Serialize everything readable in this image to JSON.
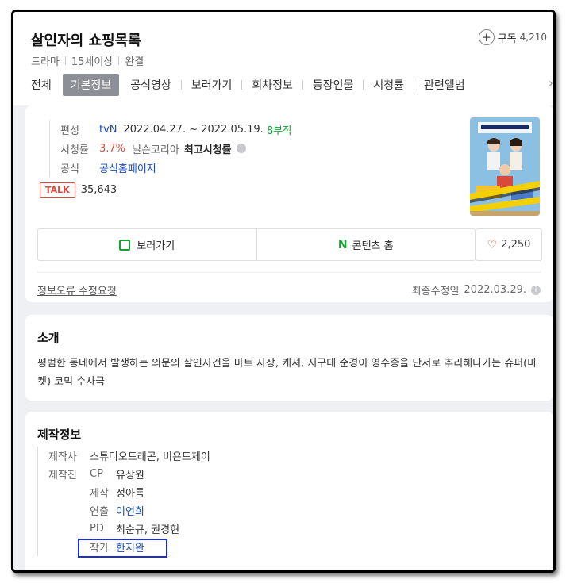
{
  "header": {
    "title": "살인자의 쇼핑목록",
    "subscribe_label": "구독",
    "subscribe_count": "4,210",
    "meta": [
      "드라마",
      "15세이상",
      "완결"
    ]
  },
  "tabs": [
    "전체",
    "기본정보",
    "공식영상",
    "보러가기",
    "회차정보",
    "등장인물",
    "시청률",
    "관련앨범"
  ],
  "active_tab": "기본정보",
  "info": {
    "broadcast_label": "편성",
    "channel": "tvN",
    "period": "2022.04.27. ~ 2022.05.19.",
    "episodes": "8부작",
    "rating_label": "시청률",
    "rating_value": "3.7%",
    "rating_source": "닐슨코리아",
    "rating_type": "최고시청률",
    "official_label": "공식",
    "official_link": "공식홈페이지",
    "talk_badge": "TALK",
    "talk_count": "35,643"
  },
  "buttons": {
    "watch": "보러가기",
    "content_home": "콘텐츠 홈",
    "like_count": "2,250"
  },
  "footer": {
    "report": "정보오류 수정요청",
    "updated_label": "최종수정일",
    "updated_date": "2022.03.29."
  },
  "intro": {
    "title": "소개",
    "text": "평범한 동네에서 발생하는 의문의 살인사건을 마트 사장, 캐셔, 지구대 순경이 영수증을 단서로 추리해나가는 슈퍼(마켓) 코믹 수사극"
  },
  "production": {
    "title": "제작정보",
    "company_label": "제작사",
    "company": "스튜디오드래곤, 비욘드제이",
    "staff_label": "제작진",
    "staff": [
      {
        "role": "CP",
        "name": "유상원"
      },
      {
        "role": "제작",
        "name": "정아름"
      },
      {
        "role": "연출",
        "name": "이언희"
      },
      {
        "role": "PD",
        "name": "최순규, 권경현"
      },
      {
        "role": "작가",
        "name": "한지완"
      }
    ]
  },
  "colors": {
    "accent_green": "#12a334",
    "accent_red": "#e0483c",
    "link_blue": "#1a4dbf",
    "highlight_box": "#1c2ecb"
  }
}
